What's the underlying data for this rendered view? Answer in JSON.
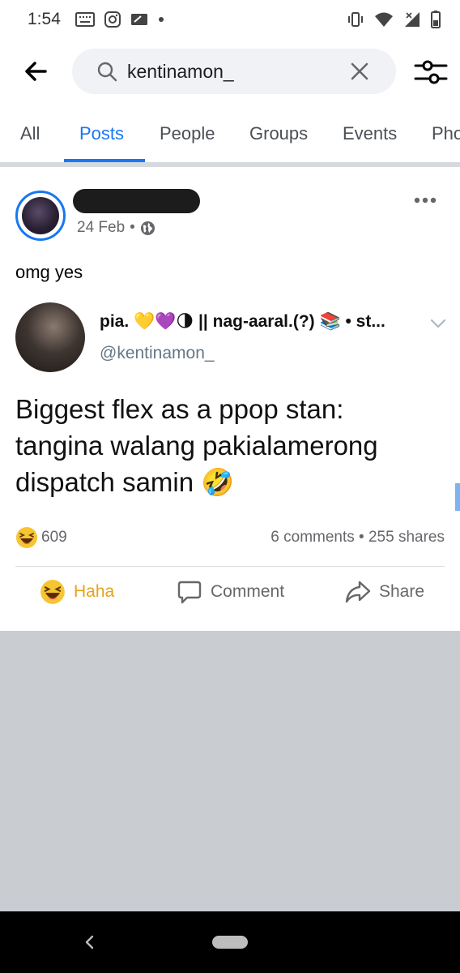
{
  "status_bar": {
    "time": "1:54",
    "left_icons": [
      "keyboard-icon",
      "instagram-icon",
      "ticket-icon",
      "dot-icon"
    ],
    "right_icons": [
      "vibrate-icon",
      "wifi-icon",
      "signal-icon",
      "battery-icon"
    ]
  },
  "search": {
    "query": "kentinamon_"
  },
  "tabs": [
    {
      "label": "All",
      "active": false
    },
    {
      "label": "Posts",
      "active": true
    },
    {
      "label": "People",
      "active": false
    },
    {
      "label": "Groups",
      "active": false
    },
    {
      "label": "Events",
      "active": false
    },
    {
      "label": "Pho",
      "active": false
    }
  ],
  "post": {
    "date": "24 Feb",
    "separator": "•",
    "text": "omg yes",
    "embedded_tweet": {
      "name": "pia. 💛💜🌗 || nag-aaral.(?) 📚 • st...",
      "handle": "@kentinamon_",
      "body": "Biggest flex as a ppop stan: tangina walang pakialamerong dispatch samin 🤣"
    },
    "reaction_count": "609",
    "comments": "6 comments",
    "shares": "255 shares",
    "counts_separator": "•",
    "actions": {
      "haha": "Haha",
      "comment": "Comment",
      "share": "Share"
    }
  },
  "colors": {
    "accent": "#1877f2",
    "haha": "#e6a218",
    "feed_background": "#c9ccd1"
  }
}
